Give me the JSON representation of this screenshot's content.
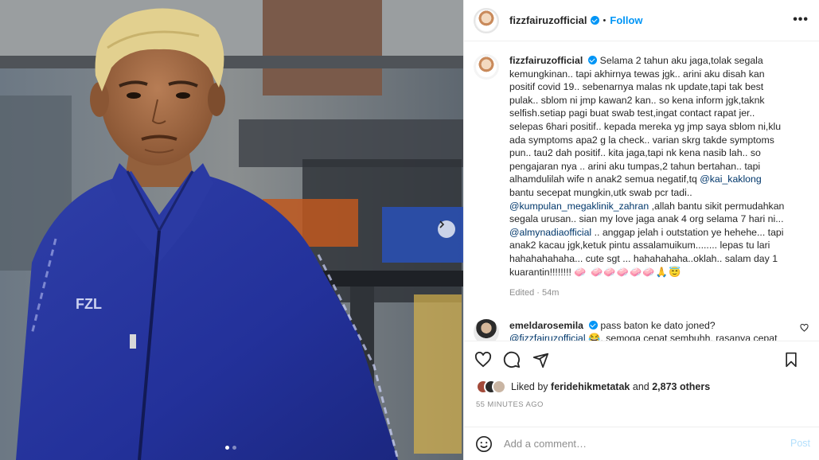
{
  "post": {
    "author": "fizzfairuzofficial",
    "follow_label": "Follow",
    "separator": "•",
    "more_label": "•••",
    "carousel": {
      "slide_count": 2,
      "active_slide": 1
    }
  },
  "caption": {
    "username": "fizzfairuzofficial",
    "text_1": "Selama 2 tahun aku jaga,tolak segala kemungkinan.. tapi akhirnya tewas jgk.. arini aku disah kan positif covid 19.. sebenarnya malas nk update,tapi tak best pulak.. sblom ni jmp kawan2 kan.. so kena inform jgk,taknk selfish.setiap pagi buat swab test,ingat contact rapat jer.. selepas 6hari positif.. kepada mereka yg jmp saya sblom ni,klu ada symptoms apa2 g la check.. varian skrg takde symptoms pun.. tau2 dah positif.. kita jaga,tapi nk kena nasib lah.. so pengajaran nya .. arini aku tumpas,2 tahun bertahan.. tapi alhamdulilah wife n anak2 semua negatif,tq",
    "mention_1": "@kai_kaklong",
    "text_2": " bantu secepat mungkin,utk swab pcr tadi..",
    "mention_2": "@kumpulan_megaklinik_zahran",
    "text_3": " ,allah bantu sikit permudahkan segala urusan.. sian my love jaga anak 4 org selama 7 hari ni...",
    "mention_3": "@almynadiaofficial",
    "text_4": " .. anggap jelah i outstation ye hehehe... tapi anak2 kacau jgk,ketuk pintu assalamuikum........ lepas tu lari hahahahahaha... cute sgt ... hahahahaha..oklah.. salam day 1 kuarantin!!!!!!!! ",
    "emojis": "🧼 🧼🧼🧼🧼🧼🙏😇",
    "edited": "Edited · 54m"
  },
  "comment": {
    "username": "emeldarosemila",
    "text_1": "pass baton ke dato joned?",
    "mention": "@fizzfairuzofficial",
    "text_2": " 😂. semoga cepat sembuhh, rasanya cepat tuu. sbb order makan banyak😢😢"
  },
  "likes": {
    "prefix": "Liked by ",
    "user": "feridehikmetatak",
    "and": " and ",
    "others": "2,873 others"
  },
  "timestamp": "55 MINUTES AGO",
  "add_comment": {
    "placeholder": "Add a comment…",
    "post_label": "Post"
  },
  "colors": {
    "link": "#0095f6",
    "mention": "#00376b",
    "muted": "#8e8e8e",
    "post_disabled": "#b2dffc"
  },
  "icons": [
    "heart-icon",
    "comment-icon",
    "share-icon",
    "bookmark-icon",
    "emoji-icon",
    "more-icon",
    "chevron-right-icon",
    "verified-badge-icon"
  ]
}
